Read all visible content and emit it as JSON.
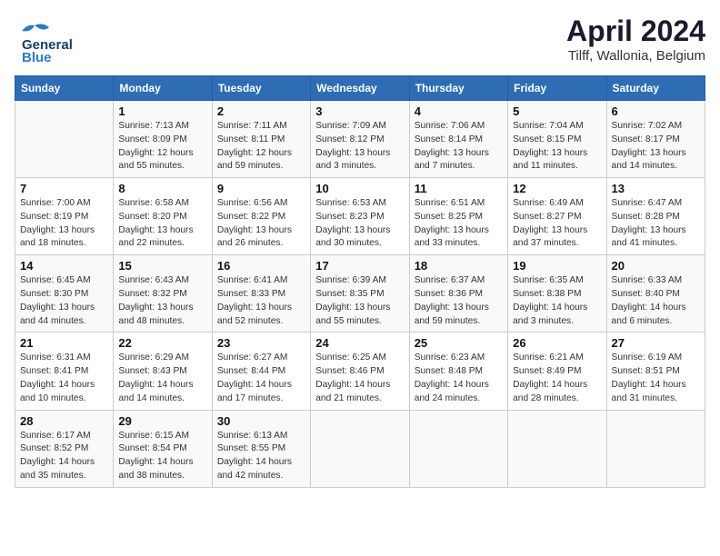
{
  "header": {
    "logo_general": "General",
    "logo_blue": "Blue",
    "title": "April 2024",
    "subtitle": "Tilff, Wallonia, Belgium"
  },
  "columns": [
    "Sunday",
    "Monday",
    "Tuesday",
    "Wednesday",
    "Thursday",
    "Friday",
    "Saturday"
  ],
  "weeks": [
    [
      {
        "day": "",
        "sunrise": "",
        "sunset": "",
        "daylight": ""
      },
      {
        "day": "1",
        "sunrise": "Sunrise: 7:13 AM",
        "sunset": "Sunset: 8:09 PM",
        "daylight": "Daylight: 12 hours and 55 minutes."
      },
      {
        "day": "2",
        "sunrise": "Sunrise: 7:11 AM",
        "sunset": "Sunset: 8:11 PM",
        "daylight": "Daylight: 12 hours and 59 minutes."
      },
      {
        "day": "3",
        "sunrise": "Sunrise: 7:09 AM",
        "sunset": "Sunset: 8:12 PM",
        "daylight": "Daylight: 13 hours and 3 minutes."
      },
      {
        "day": "4",
        "sunrise": "Sunrise: 7:06 AM",
        "sunset": "Sunset: 8:14 PM",
        "daylight": "Daylight: 13 hours and 7 minutes."
      },
      {
        "day": "5",
        "sunrise": "Sunrise: 7:04 AM",
        "sunset": "Sunset: 8:15 PM",
        "daylight": "Daylight: 13 hours and 11 minutes."
      },
      {
        "day": "6",
        "sunrise": "Sunrise: 7:02 AM",
        "sunset": "Sunset: 8:17 PM",
        "daylight": "Daylight: 13 hours and 14 minutes."
      }
    ],
    [
      {
        "day": "7",
        "sunrise": "Sunrise: 7:00 AM",
        "sunset": "Sunset: 8:19 PM",
        "daylight": "Daylight: 13 hours and 18 minutes."
      },
      {
        "day": "8",
        "sunrise": "Sunrise: 6:58 AM",
        "sunset": "Sunset: 8:20 PM",
        "daylight": "Daylight: 13 hours and 22 minutes."
      },
      {
        "day": "9",
        "sunrise": "Sunrise: 6:56 AM",
        "sunset": "Sunset: 8:22 PM",
        "daylight": "Daylight: 13 hours and 26 minutes."
      },
      {
        "day": "10",
        "sunrise": "Sunrise: 6:53 AM",
        "sunset": "Sunset: 8:23 PM",
        "daylight": "Daylight: 13 hours and 30 minutes."
      },
      {
        "day": "11",
        "sunrise": "Sunrise: 6:51 AM",
        "sunset": "Sunset: 8:25 PM",
        "daylight": "Daylight: 13 hours and 33 minutes."
      },
      {
        "day": "12",
        "sunrise": "Sunrise: 6:49 AM",
        "sunset": "Sunset: 8:27 PM",
        "daylight": "Daylight: 13 hours and 37 minutes."
      },
      {
        "day": "13",
        "sunrise": "Sunrise: 6:47 AM",
        "sunset": "Sunset: 8:28 PM",
        "daylight": "Daylight: 13 hours and 41 minutes."
      }
    ],
    [
      {
        "day": "14",
        "sunrise": "Sunrise: 6:45 AM",
        "sunset": "Sunset: 8:30 PM",
        "daylight": "Daylight: 13 hours and 44 minutes."
      },
      {
        "day": "15",
        "sunrise": "Sunrise: 6:43 AM",
        "sunset": "Sunset: 8:32 PM",
        "daylight": "Daylight: 13 hours and 48 minutes."
      },
      {
        "day": "16",
        "sunrise": "Sunrise: 6:41 AM",
        "sunset": "Sunset: 8:33 PM",
        "daylight": "Daylight: 13 hours and 52 minutes."
      },
      {
        "day": "17",
        "sunrise": "Sunrise: 6:39 AM",
        "sunset": "Sunset: 8:35 PM",
        "daylight": "Daylight: 13 hours and 55 minutes."
      },
      {
        "day": "18",
        "sunrise": "Sunrise: 6:37 AM",
        "sunset": "Sunset: 8:36 PM",
        "daylight": "Daylight: 13 hours and 59 minutes."
      },
      {
        "day": "19",
        "sunrise": "Sunrise: 6:35 AM",
        "sunset": "Sunset: 8:38 PM",
        "daylight": "Daylight: 14 hours and 3 minutes."
      },
      {
        "day": "20",
        "sunrise": "Sunrise: 6:33 AM",
        "sunset": "Sunset: 8:40 PM",
        "daylight": "Daylight: 14 hours and 6 minutes."
      }
    ],
    [
      {
        "day": "21",
        "sunrise": "Sunrise: 6:31 AM",
        "sunset": "Sunset: 8:41 PM",
        "daylight": "Daylight: 14 hours and 10 minutes."
      },
      {
        "day": "22",
        "sunrise": "Sunrise: 6:29 AM",
        "sunset": "Sunset: 8:43 PM",
        "daylight": "Daylight: 14 hours and 14 minutes."
      },
      {
        "day": "23",
        "sunrise": "Sunrise: 6:27 AM",
        "sunset": "Sunset: 8:44 PM",
        "daylight": "Daylight: 14 hours and 17 minutes."
      },
      {
        "day": "24",
        "sunrise": "Sunrise: 6:25 AM",
        "sunset": "Sunset: 8:46 PM",
        "daylight": "Daylight: 14 hours and 21 minutes."
      },
      {
        "day": "25",
        "sunrise": "Sunrise: 6:23 AM",
        "sunset": "Sunset: 8:48 PM",
        "daylight": "Daylight: 14 hours and 24 minutes."
      },
      {
        "day": "26",
        "sunrise": "Sunrise: 6:21 AM",
        "sunset": "Sunset: 8:49 PM",
        "daylight": "Daylight: 14 hours and 28 minutes."
      },
      {
        "day": "27",
        "sunrise": "Sunrise: 6:19 AM",
        "sunset": "Sunset: 8:51 PM",
        "daylight": "Daylight: 14 hours and 31 minutes."
      }
    ],
    [
      {
        "day": "28",
        "sunrise": "Sunrise: 6:17 AM",
        "sunset": "Sunset: 8:52 PM",
        "daylight": "Daylight: 14 hours and 35 minutes."
      },
      {
        "day": "29",
        "sunrise": "Sunrise: 6:15 AM",
        "sunset": "Sunset: 8:54 PM",
        "daylight": "Daylight: 14 hours and 38 minutes."
      },
      {
        "day": "30",
        "sunrise": "Sunrise: 6:13 AM",
        "sunset": "Sunset: 8:55 PM",
        "daylight": "Daylight: 14 hours and 42 minutes."
      },
      {
        "day": "",
        "sunrise": "",
        "sunset": "",
        "daylight": ""
      },
      {
        "day": "",
        "sunrise": "",
        "sunset": "",
        "daylight": ""
      },
      {
        "day": "",
        "sunrise": "",
        "sunset": "",
        "daylight": ""
      },
      {
        "day": "",
        "sunrise": "",
        "sunset": "",
        "daylight": ""
      }
    ]
  ]
}
